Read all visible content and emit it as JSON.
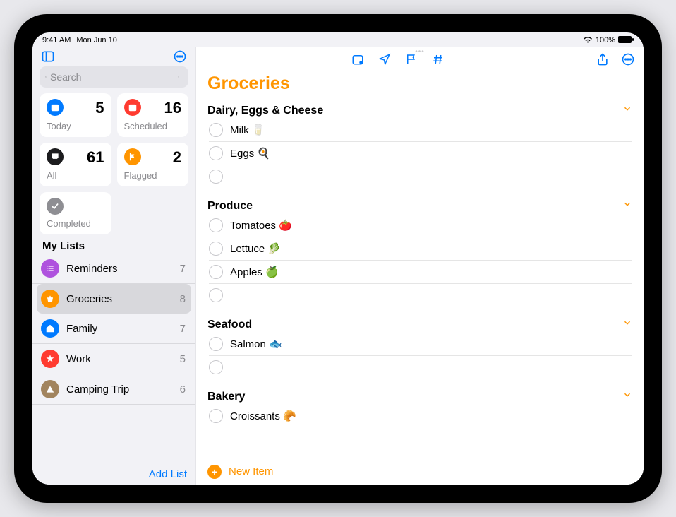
{
  "status": {
    "time": "9:41 AM",
    "date": "Mon Jun 10",
    "battery": "100%"
  },
  "search": {
    "placeholder": "Search"
  },
  "tiles": {
    "today": {
      "label": "Today",
      "count": "5"
    },
    "scheduled": {
      "label": "Scheduled",
      "count": "16"
    },
    "all": {
      "label": "All",
      "count": "61"
    },
    "flagged": {
      "label": "Flagged",
      "count": "2"
    },
    "completed": {
      "label": "Completed"
    }
  },
  "mylists_header": "My Lists",
  "lists": [
    {
      "name": "Reminders",
      "count": "7",
      "color": "#af52de",
      "icon": "list"
    },
    {
      "name": "Groceries",
      "count": "8",
      "color": "#ff9500",
      "icon": "basket",
      "selected": true
    },
    {
      "name": "Family",
      "count": "7",
      "color": "#007aff",
      "icon": "house"
    },
    {
      "name": "Work",
      "count": "5",
      "color": "#ff3b30",
      "icon": "star"
    },
    {
      "name": "Camping Trip",
      "count": "6",
      "color": "#a2845e",
      "icon": "tent"
    }
  ],
  "add_list_label": "Add List",
  "main": {
    "title": "Groceries",
    "new_item_label": "New Item",
    "sections": [
      {
        "name": "Dairy, Eggs & Cheese",
        "items": [
          "Milk 🥛",
          "Eggs 🍳"
        ],
        "blank": true
      },
      {
        "name": "Produce",
        "items": [
          "Tomatoes 🍅",
          "Lettuce 🥬",
          "Apples 🍏"
        ],
        "blank": true
      },
      {
        "name": "Seafood",
        "items": [
          "Salmon 🐟"
        ],
        "blank": true
      },
      {
        "name": "Bakery",
        "items": [
          "Croissants 🥐"
        ],
        "blank": false
      }
    ]
  }
}
